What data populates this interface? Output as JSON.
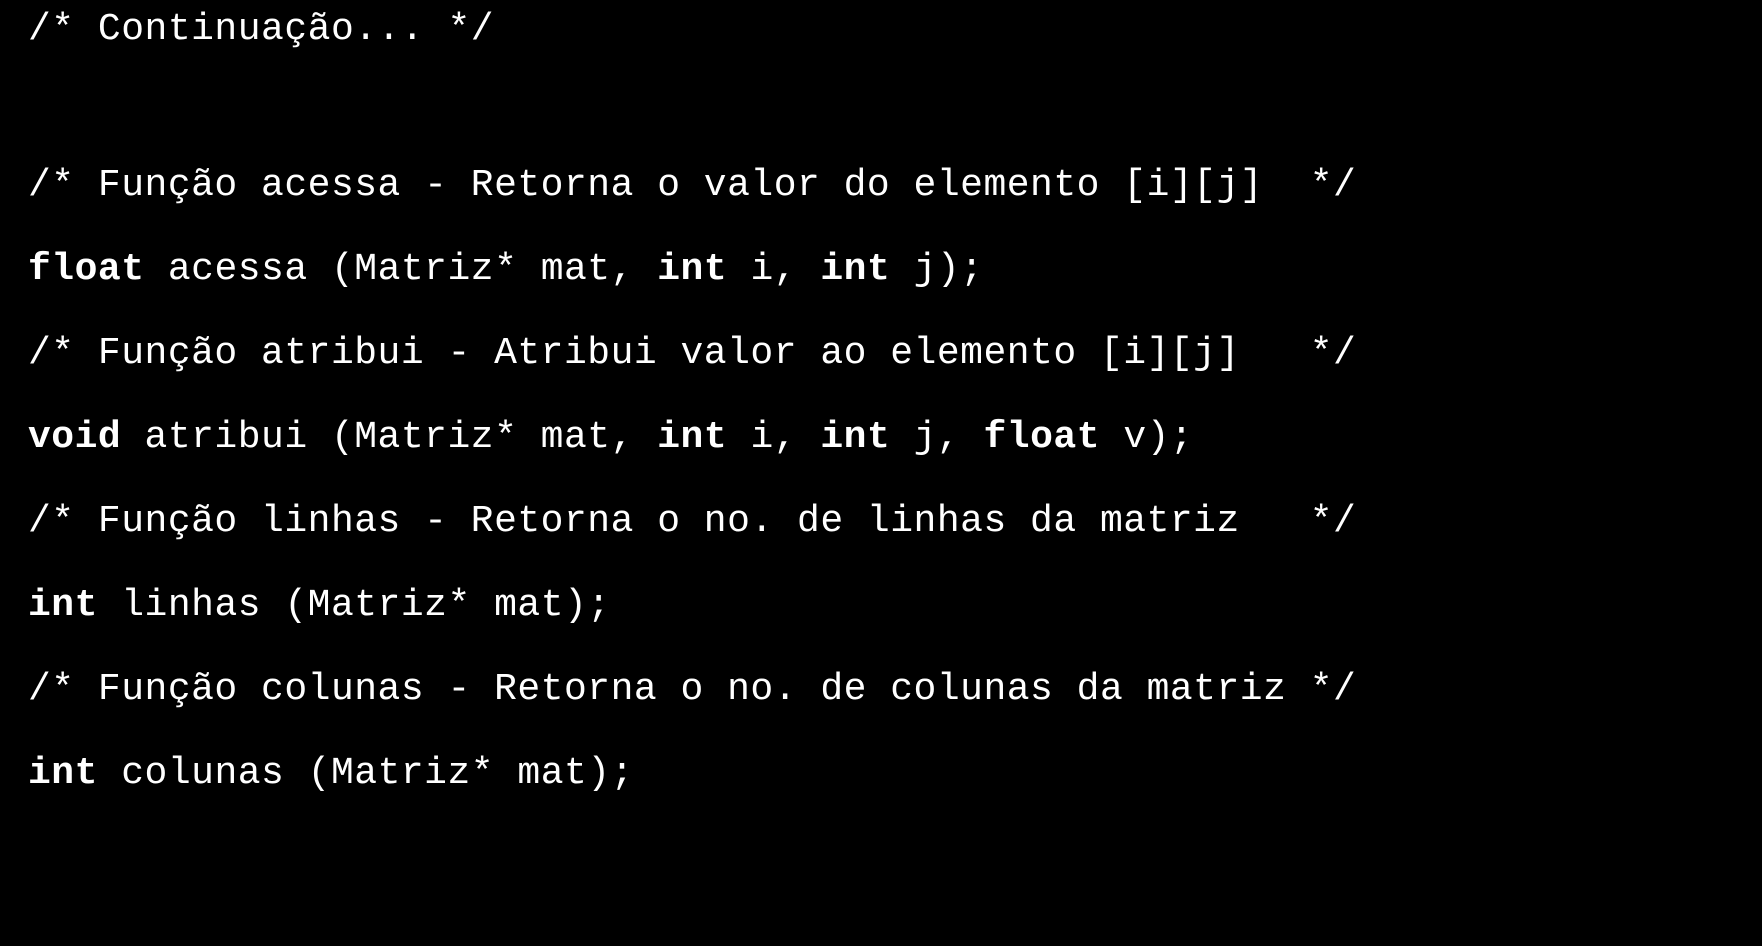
{
  "code": {
    "lines": [
      {
        "segments": [
          {
            "text": "/* Continuação... */",
            "bold": false
          }
        ]
      },
      {
        "segments": [
          {
            "text": "",
            "bold": false
          }
        ]
      },
      {
        "segments": [
          {
            "text": "/* Função acessa - Retorna o valor do elemento [i][j]  */",
            "bold": false
          }
        ]
      },
      {
        "segments": [
          {
            "text": "float",
            "bold": true
          },
          {
            "text": " acessa (Matriz* mat, ",
            "bold": false
          },
          {
            "text": "int",
            "bold": true
          },
          {
            "text": " i, ",
            "bold": false
          },
          {
            "text": "int",
            "bold": true
          },
          {
            "text": " j);",
            "bold": false
          }
        ]
      },
      {
        "segments": [
          {
            "text": "/* Função atribui - Atribui valor ao elemento [i][j]   */",
            "bold": false
          }
        ]
      },
      {
        "segments": [
          {
            "text": "void",
            "bold": true
          },
          {
            "text": " atribui (Matriz* mat, ",
            "bold": false
          },
          {
            "text": "int",
            "bold": true
          },
          {
            "text": " i, ",
            "bold": false
          },
          {
            "text": "int",
            "bold": true
          },
          {
            "text": " j, ",
            "bold": false
          },
          {
            "text": "float",
            "bold": true
          },
          {
            "text": " v);",
            "bold": false
          }
        ]
      },
      {
        "segments": [
          {
            "text": "/* Função linhas - Retorna o no. de linhas da matriz   */",
            "bold": false
          }
        ]
      },
      {
        "segments": [
          {
            "text": "int",
            "bold": true
          },
          {
            "text": " linhas (Matriz* mat);",
            "bold": false
          }
        ]
      },
      {
        "segments": [
          {
            "text": "/* Função colunas - Retorna o no. de colunas da matriz */",
            "bold": false
          }
        ]
      },
      {
        "segments": [
          {
            "text": "int",
            "bold": true
          },
          {
            "text": " colunas (Matriz* mat);",
            "bold": false
          }
        ]
      }
    ]
  }
}
